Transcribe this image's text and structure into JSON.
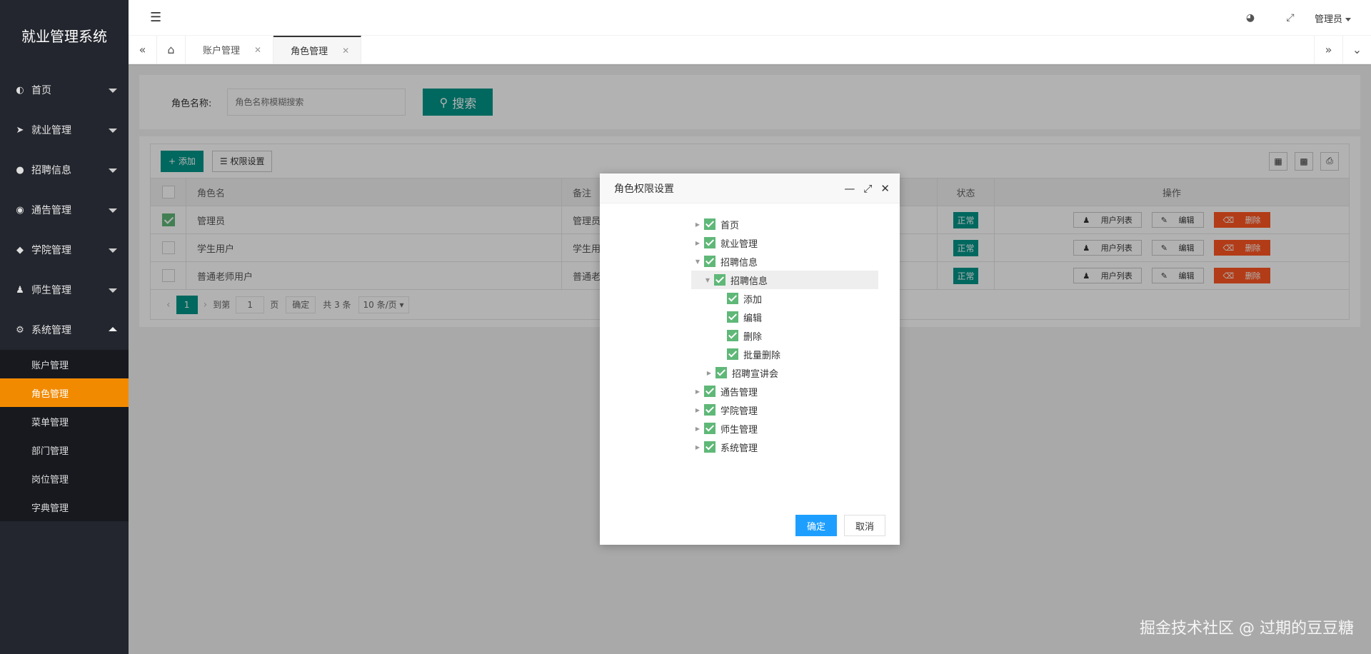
{
  "app_title": "就业管理系统",
  "sidebar": {
    "items": [
      {
        "label": "首页",
        "icon": "home-icon"
      },
      {
        "label": "就业管理",
        "icon": "send-icon"
      },
      {
        "label": "招聘信息",
        "icon": "users-icon"
      },
      {
        "label": "通告管理",
        "icon": "globe-icon"
      },
      {
        "label": "学院管理",
        "icon": "layers-icon"
      },
      {
        "label": "师生管理",
        "icon": "user-icon"
      },
      {
        "label": "系统管理",
        "icon": "gear-icon"
      }
    ],
    "sub_items": [
      "账户管理",
      "角色管理",
      "菜单管理",
      "部门管理",
      "岗位管理",
      "字典管理"
    ],
    "active_sub": "角色管理",
    "active_color": "#f28a00"
  },
  "header": {
    "user_label": "管理员"
  },
  "tabs": [
    {
      "label": "账户管理",
      "active": false
    },
    {
      "label": "角色管理",
      "active": true
    }
  ],
  "search": {
    "label": "角色名称:",
    "placeholder": "角色名称模糊搜索",
    "button": "搜索"
  },
  "toolbar": {
    "add": "添加",
    "permission": "权限设置"
  },
  "table": {
    "columns": [
      "角色名",
      "备注",
      "状态",
      "操作"
    ],
    "rows": [
      {
        "name": "管理员",
        "remark": "管理员",
        "status": "正常",
        "checked": true
      },
      {
        "name": "学生用户",
        "remark": "学生用户",
        "status": "正常",
        "checked": false
      },
      {
        "name": "普通老师用户",
        "remark": "普通老",
        "status": "正常",
        "checked": false
      }
    ],
    "ops": {
      "users": "用户列表",
      "edit": "编辑",
      "delete": "删除"
    }
  },
  "pager": {
    "current": "1",
    "goto_label": "到第",
    "page_value": "1",
    "page_unit": "页",
    "confirm": "确定",
    "total": "共 3 条",
    "page_size": "10 条/页"
  },
  "modal": {
    "title": "角色权限设置",
    "tree": [
      {
        "label": "首页",
        "level": 0,
        "expanded": false
      },
      {
        "label": "就业管理",
        "level": 0,
        "expanded": false
      },
      {
        "label": "招聘信息",
        "level": 0,
        "expanded": true
      },
      {
        "label": "招聘信息",
        "level": 1,
        "expanded": true
      },
      {
        "label": "添加",
        "level": 2,
        "expanded": false
      },
      {
        "label": "编辑",
        "level": 2,
        "expanded": false
      },
      {
        "label": "删除",
        "level": 2,
        "expanded": false
      },
      {
        "label": "批量删除",
        "level": 2,
        "expanded": false
      },
      {
        "label": "招聘宣讲会",
        "level": 1,
        "expanded": false
      },
      {
        "label": "通告管理",
        "level": 0,
        "expanded": false
      },
      {
        "label": "学院管理",
        "level": 0,
        "expanded": false
      },
      {
        "label": "师生管理",
        "level": 0,
        "expanded": false
      },
      {
        "label": "系统管理",
        "level": 0,
        "expanded": false
      }
    ],
    "ok": "确定",
    "cancel": "取消"
  },
  "watermark": "掘金技术社区 @ 过期的豆豆糖",
  "colors": {
    "primary": "#009688",
    "danger": "#ff5722",
    "blue": "#1e9fff",
    "check": "#5fb878"
  }
}
